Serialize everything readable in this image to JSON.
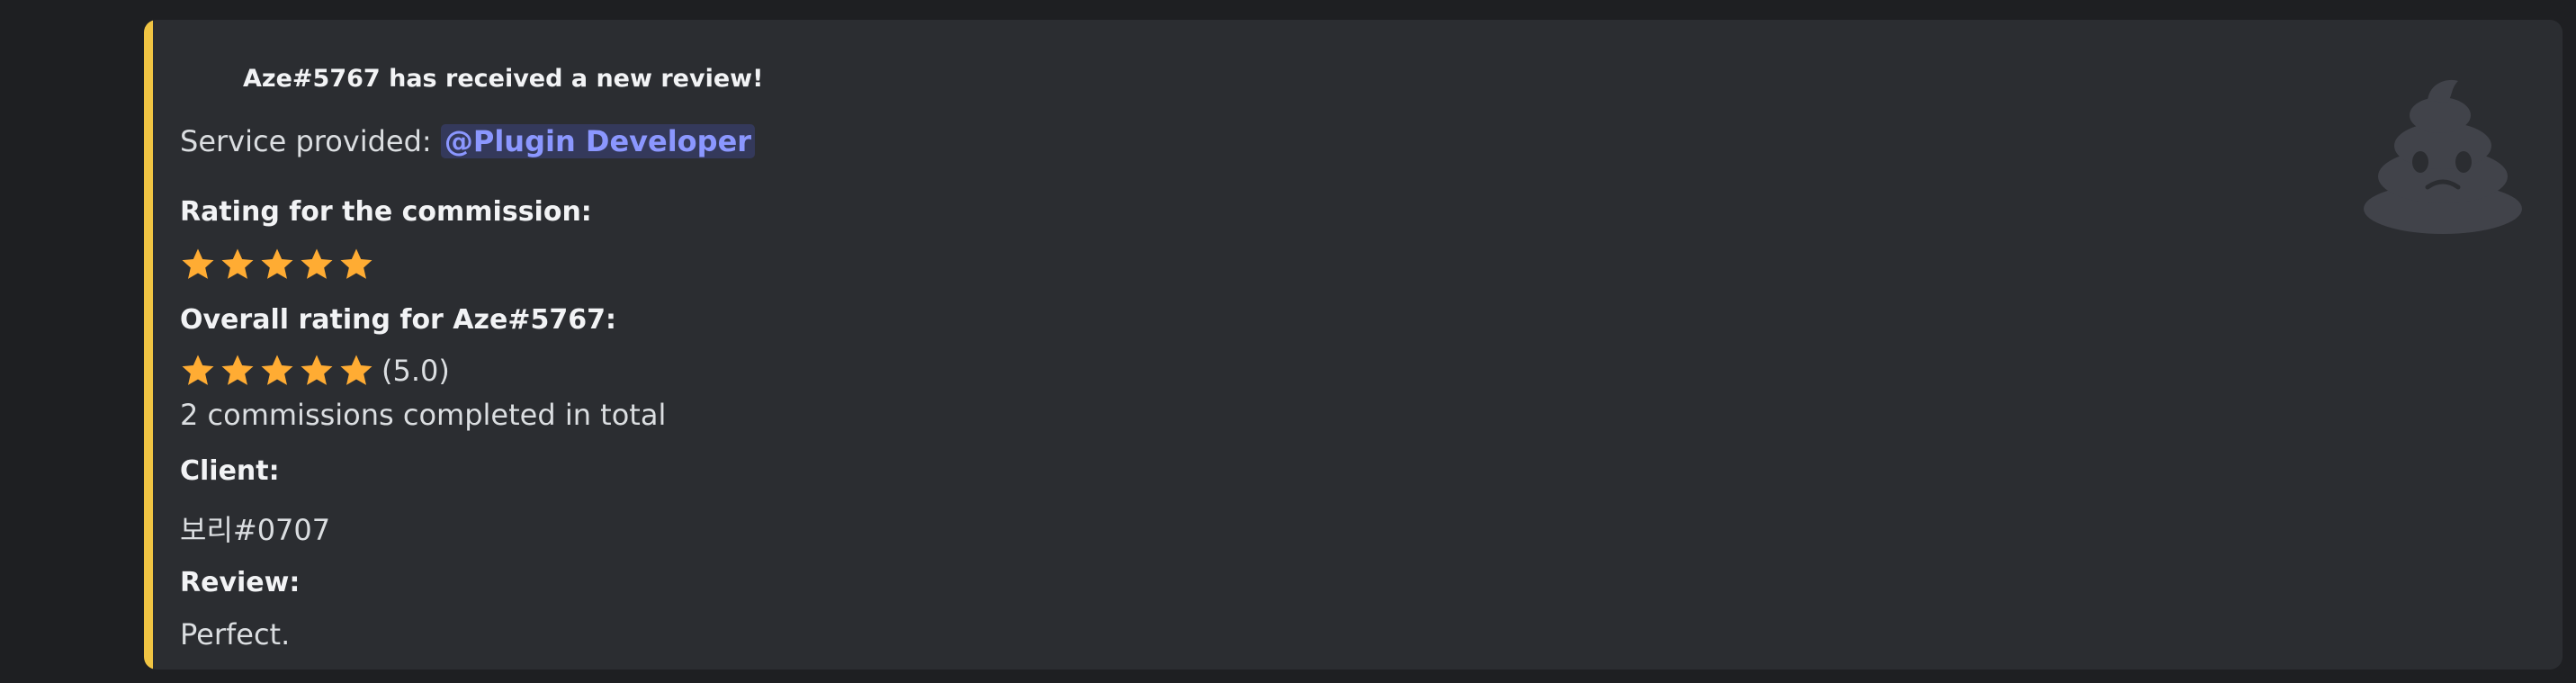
{
  "embed": {
    "accent_color": "#f0c443",
    "author": "Aze#5767 has received a new review!",
    "service_label": "Service provided: ",
    "service_mention": "@Plugin Developer",
    "fields": {
      "commission_rating_name": "Rating for the commission:",
      "commission_rating_stars": 5,
      "overall_rating_name": "Overall rating for Aze#5767:",
      "overall_rating_stars": 5,
      "overall_rating_value": "(5.0)",
      "commissions_total": "2 commissions completed in total",
      "client_name": "Client:",
      "client_value": "보리#0707",
      "review_name": "Review:",
      "review_value": "Perfect."
    },
    "thumbnail_icon": "poop-face-icon"
  }
}
